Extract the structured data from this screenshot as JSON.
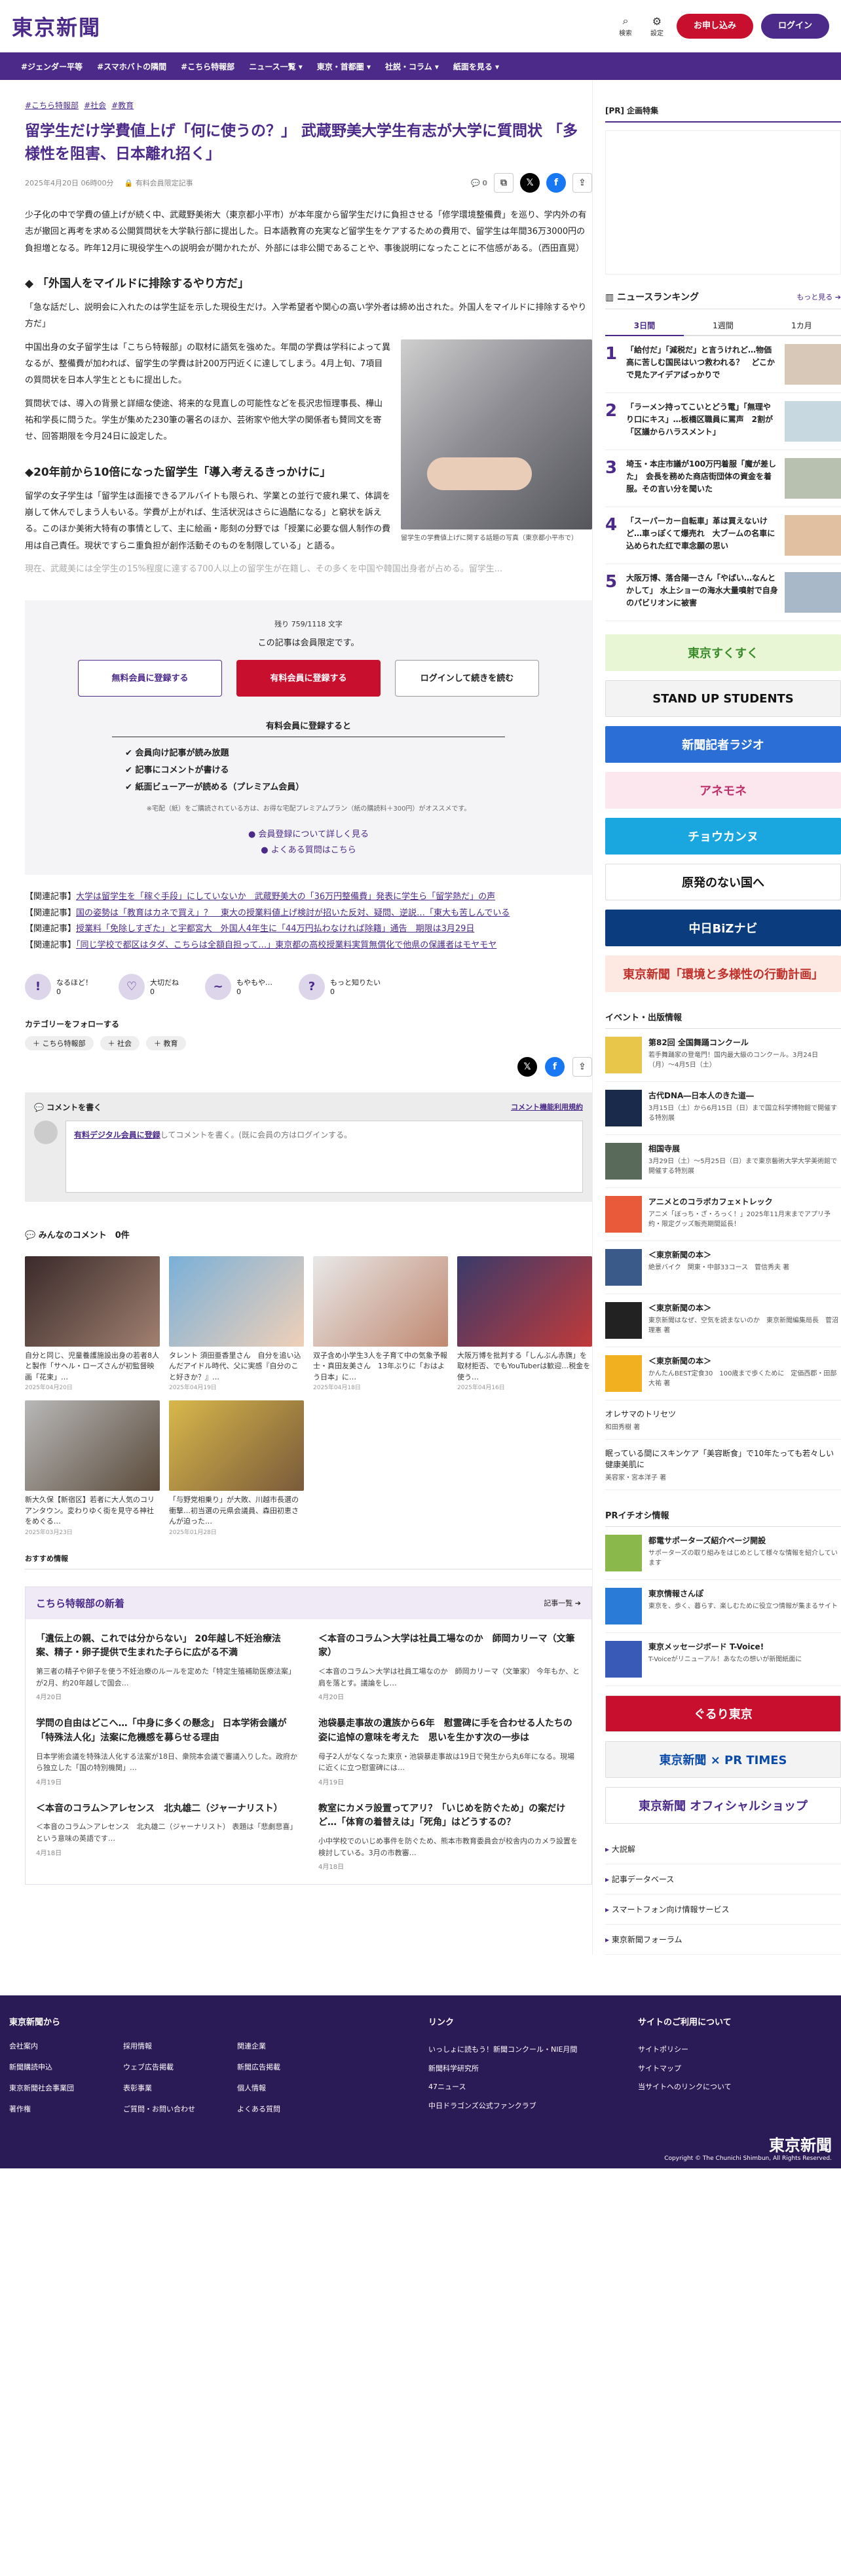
{
  "header": {
    "logo": "東京新聞",
    "search_label": "検索",
    "settings_label": "設定",
    "apply": "お申し込み",
    "login": "ログイン"
  },
  "nav": [
    "#ジェンダー平等",
    "#スマホバトの隣間",
    "#こちら特報部",
    "ニュース一覧 ▾",
    "東京・首都圏 ▾",
    "社説・コラム ▾",
    "紙面を見る ▾"
  ],
  "article": {
    "tags": [
      "#こちら特報部",
      "#社会",
      "#教育"
    ],
    "title": "留学生だけ学費値上げ「何に使うの？」 武蔵野美大学生有志が大学に質問状 「多様性を阻害、日本離れ招く」",
    "date": "2025年4月20日 06時00分",
    "member_badge": "有料会員限定記事",
    "comments_count": "0",
    "lead": "少子化の中で学費の値上げが続く中、武蔵野美術大（東京都小平市）が本年度から留学生だけに負担させる「修学環境整備費」を巡り、学内外の有志が撤回と再考を求める公開質問状を大学執行部に提出した。日本語教育の充実など留学生をケアするための費用で、留学生は年間36万3000円の負担増となる。昨年12月に現役学生への説明会が開かれたが、外部には非公開であることや、事後説明になったことに不信感がある。（西田直晃）",
    "h2_1": "「外国人をマイルドに排除するやり方だ」",
    "p1": "「急な話だし、説明会に入れたのは学生証を示した現役生だけ。入学希望者や関心の高い学外者は締め出された。外国人をマイルドに排除するやり方だ」",
    "p2": "中国出身の女子留学生は「こちら特報部」の取材に語気を強めた。年間の学費は学科によって異なるが、整備費が加われば、留学生の学費は計200万円近くに達してしまう。4月上旬、7項目の質問状を日本人学生とともに提出した。",
    "p3": "質問状では、導入の背景と詳細な使途、将来的な見直しの可能性などを長沢忠恒理事長、樺山祐和学長に問うた。学生が集めた230筆の署名のほか、芸術家や他大学の関係者も賛同文を寄せ、回答期限を今月24日に設定した。",
    "fig_caption": "留学生の学費値上げに関する話題の写真（東京都小平市で）",
    "h2_2": "20年前から10倍になった留学生「導入考えるきっかけに」",
    "p4": "留学の女子学生は「留学生は面接できるアルバイトも限られ、学業との並行で疲れ果て、体調を崩して休んでしまう人もいる。学費が上がれば、生活状況はさらに過酷になる」と窮状を訴える。このほか美術大特有の事情として、主に絵画・彫刻の分野では「授業に必要な個人制作の費用は自己責任。現状ですらニ重負担が創作活動そのものを制限している」と語る。",
    "p5": "現在、武蔵美には全学生の15%程度に達する700人以上の留学生が在籍し、その多くを中国や韓国出身者が占める。留学生...",
    "paywall": {
      "remaining": "残り 759/1118 文字",
      "message": "この記事は会員限定です。",
      "btn_free": "無料会員に登録する",
      "btn_paid": "有料会員に登録する",
      "btn_login": "ログインして続きを読む",
      "benefit_title": "有料会員に登録すると",
      "benefits": [
        "会員向け記事が読み放題",
        "記事にコメントが書ける",
        "紙面ビューアーが読める（プレミアム会員）"
      ],
      "note": "※宅配（紙）をご購読されている方は、お得な宅配プレミアムプラン（紙の購読料＋300円）がオススメです。",
      "link1": "会員登録について詳しく見る",
      "link2": "よくある質問はこちら"
    },
    "related": [
      {
        "label": "【関連記事】",
        "text": "大学は留学生を「稼ぐ手段」にしていないか　武蔵野美大の「36万円整備費」発表に学生ら「留学熱だ」の声"
      },
      {
        "label": "【関連記事】",
        "text": "国の姿勢は「教育はカネで買え」？　東大の授業料値上げ検討が招いた反対、疑問、逆説…「東大も苦しんでいる"
      },
      {
        "label": "【関連記事】",
        "text": "授業料「免除しすぎた」と宇都宮大　外国人4年生に「44万円払わなければ除籍」通告　期限は3月29日"
      },
      {
        "label": "【関連記事】",
        "text": "「同じ学校で都区はタダ、こちらは全額自担って…」東京都の高校授業料実質無償化で他県の保護者はモヤモヤ"
      }
    ],
    "reactions": [
      {
        "icon": "!",
        "label": "なるほど！",
        "count": "0"
      },
      {
        "icon": "♡",
        "label": "大切だね",
        "count": "0"
      },
      {
        "icon": "~",
        "label": "もやもや…",
        "count": "0"
      },
      {
        "icon": "?",
        "label": "もっと知りたい",
        "count": "0"
      }
    ],
    "follow_title": "カテゴリーをフォローする",
    "follow_chips": [
      "＋ こちら特報部",
      "＋ 社会",
      "＋ 教育"
    ]
  },
  "comment_box": {
    "title": "コメントを書く",
    "rules": "コメント機能利用規約",
    "member_link": "有料デジタル会員に登録",
    "placeholder_rest": "してコメントを書く。(既に会員の方はログインする。"
  },
  "member_comments": {
    "title": "みんなのコメント　0件",
    "items": [
      {
        "text": "自分と同じ、児童養護施設出身の若者8人と製作「サヘル・ローズさんが初監督映画「花束」…",
        "date": "2025年04月20日"
      },
      {
        "text": "タレント 須田亜香里さん　自分を追い込んだアイドル時代、父に実感『自分のこと好きか？』…",
        "date": "2025年04月19日"
      },
      {
        "text": "双子含め小学生3人を子育て中の気象予報士・真田友美さん　13年ぶりに「おはよう日本」に…",
        "date": "2025年04月18日"
      },
      {
        "text": "大阪万博を批判する「しんぶん赤旗」を取材拒否、でもYouTuberは歓迎…税金を使う…",
        "date": "2025年04月16日"
      },
      {
        "text": "新大久保【新宿区】若者に大人気のコリアンタウン。変わりゆく街を見守る神社をめぐる…",
        "date": "2025年03月23日"
      },
      {
        "text": "「与野党相乗り」が大敗、川越市長選の衝撃…初当選の元県会議員、森田初恵さんが迫った…",
        "date": "2025年01月28日"
      }
    ]
  },
  "recommend_title": "おすすめ情報",
  "kochira": {
    "title": "こちら特報部の新着",
    "more": "記事一覧 ➔",
    "items": [
      {
        "title": "「遺伝上の親、これでは分からない」 20年越し不妊治療法案、精子・卵子提供で生まれた子らに広がる不満",
        "sub": "第三者の精子や卵子を使う不妊治療のルールを定めた「特定生殖補助医療法案」が2月、約20年越しで国会…",
        "date": "4月20日"
      },
      {
        "title": "＜本音のコラム＞大学は社員工場なのか　師岡カリーマ（文筆家）",
        "sub": "＜本音のコラム＞大学は社員工場なのか　師岡カリーマ（文筆家） 今年もか、と肩を落とす。議論をし…",
        "date": "4月20日"
      },
      {
        "title": "学問の自由はどこへ…「中身に多くの懸念」 日本学術会議が「特殊法人化」法案に危機感を募らせる理由",
        "sub": "日本学術会議を特殊法人化する法案が18日、衆院本会議で審議入りした。政府から独立した「国の特別機関」…",
        "date": "4月19日"
      },
      {
        "title": "池袋暴走事故の遺族から6年　慰霊碑に手を合わせる人たちの姿に追悼の意味を考えた　思いを生かす次の一歩は",
        "sub": "母子2人がなくなった東京・池袋暴走事故は19日で発生から丸6年になる。現場に近くに立つ慰霊碑には…",
        "date": "4月19日"
      },
      {
        "title": "＜本音のコラム＞アレセンス　北丸雄二（ジャーナリスト）",
        "sub": "＜本音のコラム＞アレセンス　北丸雄二（ジャーナリスト） 表題は「悲劇悲喜」という意味の英語です…",
        "date": "4月18日"
      },
      {
        "title": "教室にカメラ設置ってアリ？「いじめを防ぐため」の案だけど…「体育の着替えは」「死角」はどうするの？",
        "sub": "小中学校でのいじめ事件を防ぐため、熊本市教育委員会が校舎内のカメラ設置を検討している。3月の市教審…",
        "date": "4月18日"
      }
    ]
  },
  "sidebar": {
    "pr_title": "[PR] 企画特集",
    "ranking_title": "ニュースランキング",
    "ranking_more": "もっと見る ➔",
    "tabs": [
      "3日間",
      "1週間",
      "1カ月"
    ],
    "ranking": [
      {
        "n": "1",
        "t": "「給付だ」「減税だ」と言うけれど…物価高に苦しむ国民はいつ救われる？　どこかで見たアイデアばっかりで"
      },
      {
        "n": "2",
        "t": "「ラーメン持ってこいとどう電」「無理やり口にキス」…板橋区職員に罵声　2割が「区議からハラスメント」"
      },
      {
        "n": "3",
        "t": "埼玉・本庄市議が100万円着服「魔が差した」　会長を務めた商店街団体の資金を着服。その言い分を聞いた"
      },
      {
        "n": "4",
        "t": "「スーパーカー自転車」革は買えないけど…車っぽくて爆売れ　大ブームの名車に込められた红で車念願の思い"
      },
      {
        "n": "5",
        "t": "大阪万博、落合陽一さん「やばい…なんとかして」 水上ショーの海水大量噴射で自身のパビリオンに被害"
      }
    ],
    "banners": [
      {
        "text": "東京すくすく",
        "bg": "#e8f6d6",
        "fg": "#3a8a2a"
      },
      {
        "text": "STAND UP STUDENTS",
        "bg": "#f3f3f3",
        "fg": "#111"
      },
      {
        "text": "新聞記者ラジオ",
        "bg": "#2a6ed6",
        "fg": "#fff"
      },
      {
        "text": "アネモネ",
        "bg": "#fde7ef",
        "fg": "#c0306a"
      },
      {
        "text": "チョウカンヌ",
        "bg": "#1aa7e0",
        "fg": "#fff"
      },
      {
        "text": "原発のない国へ",
        "bg": "#fff",
        "fg": "#111"
      },
      {
        "text": "中日BiZナビ",
        "bg": "#0b3c7d",
        "fg": "#fff"
      },
      {
        "text": "東京新聞「環境と多様性の行動計画」",
        "bg": "#fde9e2",
        "fg": "#c0302a"
      }
    ],
    "events_title": "イベント・出版情報",
    "events": [
      {
        "t": "第82回 全国舞踊コンクール",
        "s": "若手舞踊家の登竜門！国内最大級のコンクール。3月24日（月）〜4月5日（土）",
        "c": "#e8c64a"
      },
      {
        "t": "古代DNA―日本人のきた道―",
        "s": "3月15日（土）から6月15日（日）まで国立科学博物館で開催する特別展",
        "c": "#1a2a4a"
      },
      {
        "t": "相国寺展",
        "s": "3月29日（土）〜5月25日（日）まで東京藝術大学大学美術館で開催する特別展",
        "c": "#5a6a5a"
      },
      {
        "t": "アニメとのコラボカフェ×トレック",
        "s": "アニメ「ぼっち・ざ・ろっく！」2025年11月末までアプリ予約・限定グッズ販売期間延長！",
        "c": "#e85a3a"
      },
      {
        "t": "＜東京新聞の本＞",
        "s": "絶景バイク　関東・中部33コース　菅信秀夫 著",
        "c": "#3a5a8a"
      },
      {
        "t": "＜東京新聞の本＞",
        "s": "東京新聞はなぜ、空気を読まないのか　東京新聞編集局長　菅沼理憲 著",
        "c": "#222"
      },
      {
        "t": "＜東京新聞の本＞",
        "s": "かんたんBEST定食30　100歳まで歩くために　定価西郡・田部大祐 著",
        "c": "#f0b020"
      }
    ],
    "small_links": [
      {
        "t": "オレサマのトリセツ",
        "s": "和田秀樹 著"
      },
      {
        "t": "眠っている間にスキンケア「美容断食」で10年たっても若々しい健康美肌に",
        "s": "美容家・宮本洋子 著"
      }
    ],
    "pr_info_title": "PRイチオシ情報",
    "pr_items": [
      {
        "t": "都電サポーターズ紹介ページ開設",
        "s": "サポーターズの取り組みをはじめとして様々な情報を紹介しています"
      },
      {
        "t": "東京情報さんぽ",
        "s": "東京を、歩く、暮らす、楽しむために役立つ情報が集まるサイト"
      },
      {
        "t": "東京メッセージボード T-Voice!",
        "s": "T-Voiceがリニューアル！あなたの想いが新聞紙面に"
      }
    ],
    "pr_banners": [
      {
        "text": "ぐるり東京",
        "bg": "#c8102e",
        "fg": "#fff"
      },
      {
        "text": "東京新聞 × PR TIMES",
        "bg": "#f3f3f3",
        "fg": "#0a4aa8"
      },
      {
        "text": "東京新聞 オフィシャルショップ",
        "bg": "#fff",
        "fg": "#4b2a8a"
      }
    ],
    "bottom_links": [
      "大説解",
      "記事データベース",
      "スマートフォン向け情報サービス",
      "東京新聞フォーラム"
    ]
  },
  "footer": {
    "col1_title": "東京新聞から",
    "col1_links": [
      "会社案内",
      "採用情報",
      "関連企業",
      "新聞購読申込",
      "ウェブ広告掲載",
      "新聞広告掲載",
      "東京新聞社会事業団",
      "表彰事業",
      "個人情報",
      "著作権",
      "ご質問・お問い合わせ",
      "よくある質問"
    ],
    "col2_title": "リンク",
    "col2_links": [
      "いっしょに読もう！新聞コンクール・NIE月間",
      "新聞科学研究所",
      "47ニュース",
      "中日ドラゴンズ公式ファンクラブ"
    ],
    "col3_title": "サイトのご利用について",
    "col3_links": [
      "サイトポリシー",
      "サイトマップ",
      "当サイトへのリンクについて"
    ],
    "logo": "東京新聞",
    "copyright": "Copyright © The Chunichi Shimbun, All Rights Reserved."
  }
}
